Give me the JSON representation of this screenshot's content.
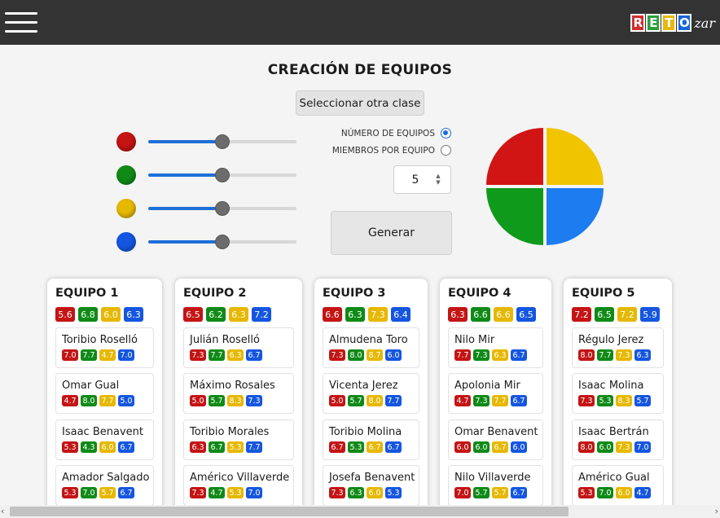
{
  "header": {
    "menu_icon": "hamburger-menu-icon",
    "logo_letters": [
      "R",
      "E",
      "T",
      "O"
    ],
    "logo_suffix": "zar",
    "logo_colors": [
      "#d32f2f",
      "#2e9e3c",
      "#e8b90c",
      "#1565d8"
    ]
  },
  "page_title": "CREACIÓN DE EQUIPOS",
  "select_class_label": "Seleccionar otra clase",
  "colors": {
    "red": "#c41414",
    "green": "#0f8a17",
    "yellow": "#e6b800",
    "blue": "#1556e0"
  },
  "sliders": [
    {
      "color": "#c41414",
      "value": 50
    },
    {
      "color": "#0f8a17",
      "value": 50
    },
    {
      "color": "#e6b800",
      "value": 50
    },
    {
      "color": "#1556e0",
      "value": 50
    }
  ],
  "options": {
    "num_teams_label": "NÚMERO DE EQUIPOS",
    "members_per_team_label": "MIEMBROS POR EQUIPO",
    "selected": "num_teams"
  },
  "count_value": "5",
  "generate_label": "Generar",
  "pie_colors": [
    "#f1c400",
    "#1c7cf0",
    "#0f9a1c",
    "#d11515"
  ],
  "teams": [
    {
      "name": "EQUIPO 1",
      "avgs": [
        "5.6",
        "6.8",
        "6.0",
        "6.3"
      ],
      "members": [
        {
          "name": "Toribio Roselló",
          "scores": [
            "7.0",
            "7.7",
            "4.7",
            "7.0"
          ]
        },
        {
          "name": "Omar Gual",
          "scores": [
            "4.7",
            "8.0",
            "7.7",
            "5.0"
          ]
        },
        {
          "name": "Isaac Benavent",
          "scores": [
            "5.3",
            "4.3",
            "6.0",
            "6.7"
          ]
        },
        {
          "name": "Amador Salgado",
          "scores": [
            "5.3",
            "7.0",
            "5.7",
            "6.7"
          ]
        }
      ]
    },
    {
      "name": "EQUIPO 2",
      "avgs": [
        "6.5",
        "6.2",
        "6.3",
        "7.2"
      ],
      "members": [
        {
          "name": "Julián Roselló",
          "scores": [
            "7.3",
            "7.7",
            "6.3",
            "6.7"
          ]
        },
        {
          "name": "Máximo Rosales",
          "scores": [
            "5.0",
            "5.7",
            "8.3",
            "7.3"
          ]
        },
        {
          "name": "Toribio Morales",
          "scores": [
            "6.3",
            "6.7",
            "5.3",
            "7.7"
          ]
        },
        {
          "name": "Américo Villaverde",
          "scores": [
            "7.3",
            "4.7",
            "5.3",
            "7.0"
          ]
        }
      ]
    },
    {
      "name": "EQUIPO 3",
      "avgs": [
        "6.6",
        "6.3",
        "7.3",
        "6.4"
      ],
      "members": [
        {
          "name": "Almudena Toro",
          "scores": [
            "7.3",
            "8.0",
            "8.7",
            "6.0"
          ]
        },
        {
          "name": "Vicenta Jerez",
          "scores": [
            "5.0",
            "5.7",
            "8.0",
            "7.7"
          ]
        },
        {
          "name": "Toribio Molina",
          "scores": [
            "6.7",
            "5.3",
            "6.7",
            "6.7"
          ]
        },
        {
          "name": "Josefa Benavent",
          "scores": [
            "7.3",
            "6.3",
            "6.0",
            "5.3"
          ]
        }
      ]
    },
    {
      "name": "EQUIPO 4",
      "avgs": [
        "6.3",
        "6.6",
        "6.6",
        "6.5"
      ],
      "members": [
        {
          "name": "Nilo Mir",
          "scores": [
            "7.7",
            "7.3",
            "6.3",
            "6.7"
          ]
        },
        {
          "name": "Apolonia Mir",
          "scores": [
            "4.7",
            "7.3",
            "7.7",
            "6.7"
          ]
        },
        {
          "name": "Omar Benavent",
          "scores": [
            "6.0",
            "6.0",
            "6.7",
            "6.0"
          ]
        },
        {
          "name": "Nilo Villaverde",
          "scores": [
            "7.0",
            "5.7",
            "5.7",
            "6.7"
          ]
        }
      ]
    },
    {
      "name": "EQUIPO 5",
      "avgs": [
        "7.2",
        "6.5",
        "7.2",
        "5.9"
      ],
      "members": [
        {
          "name": "Régulo Jerez",
          "scores": [
            "8.0",
            "7.7",
            "7.3",
            "6.3"
          ]
        },
        {
          "name": "Isaac Molina",
          "scores": [
            "7.3",
            "5.3",
            "8.3",
            "5.7"
          ]
        },
        {
          "name": "Isaac Bertrán",
          "scores": [
            "8.0",
            "6.0",
            "7.3",
            "7.0"
          ]
        },
        {
          "name": "Américo Gual",
          "scores": [
            "5.3",
            "7.0",
            "6.0",
            "4.7"
          ]
        }
      ]
    }
  ]
}
